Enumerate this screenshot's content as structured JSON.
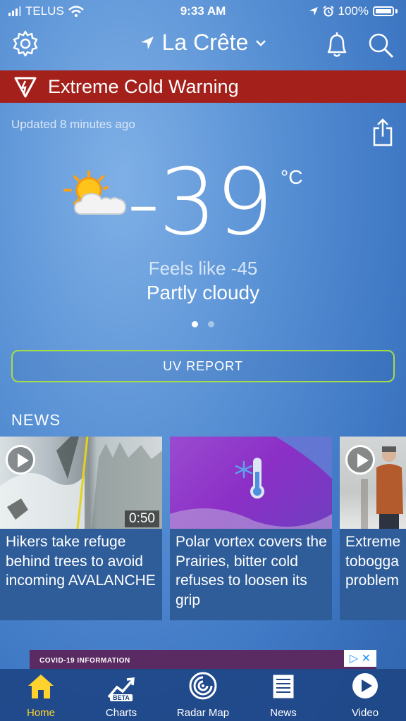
{
  "status_bar": {
    "carrier": "TELUS",
    "time": "9:33 AM",
    "battery": "100%"
  },
  "header": {
    "location": "La Crête"
  },
  "alert": {
    "text": "Extreme Cold Warning",
    "color": "#a3201b"
  },
  "updated": "Updated 8 minutes ago",
  "current": {
    "temperature": "-39",
    "unit": "°C",
    "feels_like": "Feels like -45",
    "condition": "Partly cloudy",
    "condition_icon": "sun-cloud-icon",
    "page_dots": 2,
    "active_dot": 1
  },
  "uv_button": {
    "label": "UV REPORT",
    "border_color": "#a6dc4a"
  },
  "news": {
    "heading": "NEWS",
    "items": [
      {
        "title": "Hikers take refuge behind trees to avoid incoming AVALANCHE",
        "duration": "0:50",
        "has_play": true
      },
      {
        "title": "Polar vortex covers the Prairies, bitter cold refuses to loosen its grip",
        "has_play": false
      },
      {
        "title": "Extreme tobogga problem",
        "has_play": true
      }
    ]
  },
  "ad": {
    "label": "COVID-19 INFORMATION",
    "close_glyphs": "▷ ✕"
  },
  "tabs": [
    {
      "label": "Home",
      "icon": "home-icon",
      "active": true
    },
    {
      "label": "Charts",
      "icon": "chart-icon",
      "badge": "BETA",
      "active": false
    },
    {
      "label": "Radar Map",
      "icon": "radar-icon",
      "active": false
    },
    {
      "label": "News",
      "icon": "newspaper-icon",
      "active": false
    },
    {
      "label": "Video",
      "icon": "play-icon",
      "active": false
    }
  ],
  "colors": {
    "accent_active_tab": "#ffd22e",
    "background": "#4f88cf"
  }
}
